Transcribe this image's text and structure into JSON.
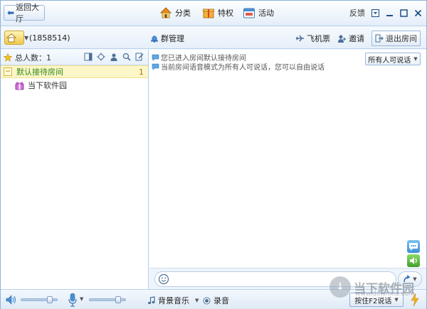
{
  "titlebar": {
    "back_label": "返回大厅",
    "nav": [
      {
        "label": "分类",
        "icon": "house-icon"
      },
      {
        "label": "特权",
        "icon": "gift-icon"
      },
      {
        "label": "活动",
        "icon": "calendar-icon"
      }
    ],
    "feedback_label": "反馈",
    "controls": [
      "menu-icon",
      "minimize-icon",
      "maximize-icon",
      "close-icon"
    ]
  },
  "toolbar": {
    "room_id": "(1858514)",
    "group_manage_label": "群管理",
    "flight_label": "飞机票",
    "invite_label": "邀请",
    "exit_label": "退出房间"
  },
  "left": {
    "total_label": "总人数：1",
    "room_name": "默认接待房间",
    "room_count": "1",
    "members": [
      {
        "name": "当下软件园"
      }
    ]
  },
  "chat": {
    "messages": [
      "您已进入房间默认接待房间",
      "当前房间语音模式为所有人可说话，您可以自由说话"
    ],
    "speak_mode": "所有人可说话"
  },
  "bottom": {
    "music_label": "背景音乐",
    "record_label": "录音",
    "hold_talk_label": "按住F2说话"
  },
  "watermark": {
    "text": "当下软件园",
    "sub": "www.downxia.com"
  },
  "colors": {
    "accent": "#2a6bb3",
    "room_name": "#2f8a1a",
    "room_bg": "#fdf6c9"
  },
  "levels": {
    "speaker_volume": 0.85,
    "mic_volume": 0.85
  }
}
